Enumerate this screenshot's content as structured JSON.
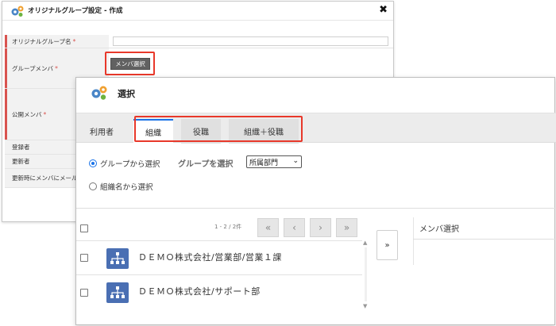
{
  "back_dialog": {
    "title": "オリジナルグループ設定 - 作成",
    "close_glyph": "✖",
    "rows": [
      {
        "label": "オリジナルグループ名",
        "required": "*"
      },
      {
        "label": "グループメンバ",
        "required": "*"
      },
      {
        "label": "公開メンバ",
        "required": "*"
      },
      {
        "label": "登録者",
        "required": ""
      },
      {
        "label": "更新者",
        "required": ""
      },
      {
        "label": "更新時にメンバにメール",
        "required": ""
      }
    ],
    "member_button": "メンバ選択"
  },
  "dialog": {
    "title": "選択",
    "tabs": [
      {
        "label": "利用者",
        "state": "plain"
      },
      {
        "label": "組織",
        "state": "active"
      },
      {
        "label": "役職",
        "state": "inactive"
      },
      {
        "label": "組織＋役職",
        "state": "inactive"
      }
    ],
    "radio_group": "グループから選択",
    "radio_org": "組織名から選択",
    "group_select_label": "グループを選択",
    "group_select_value": "所属部門",
    "pagination": {
      "count": "1 - 2 / 2件",
      "first": "«",
      "prev": "‹",
      "next": "›",
      "last": "»"
    },
    "items": [
      {
        "name": "ＤＥＭＯ株式会社/営業部/営業１課"
      },
      {
        "name": "ＤＥＭＯ株式会社/サポート部"
      }
    ],
    "move_button": "»",
    "selected_panel_title": "メンバ選択"
  },
  "colors": {
    "accent": "#1a73e8",
    "highlight": "#e8382a",
    "required": "#d9534f",
    "org_icon": "#4a6fb3"
  },
  "icons": [
    "gears-icon",
    "close-icon",
    "org-tree-icon",
    "chevron-down-icon"
  ]
}
